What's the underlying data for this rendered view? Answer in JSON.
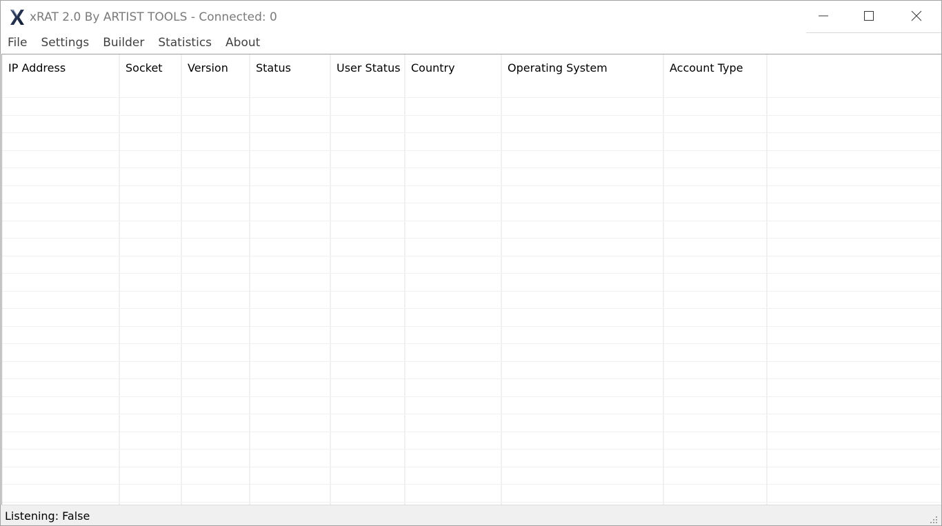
{
  "window": {
    "title": "xRAT 2.0 By ARTIST TOOLS - Connected: 0",
    "app_icon": "x-logo-icon",
    "controls": [
      "minimize-icon",
      "maximize-icon",
      "close-icon"
    ]
  },
  "menu": {
    "items": [
      {
        "label": "File"
      },
      {
        "label": "Settings"
      },
      {
        "label": "Builder"
      },
      {
        "label": "Statistics"
      },
      {
        "label": "About"
      }
    ]
  },
  "table": {
    "columns": [
      {
        "label": "IP Address"
      },
      {
        "label": "Socket"
      },
      {
        "label": "Version"
      },
      {
        "label": "Status"
      },
      {
        "label": "User Status"
      },
      {
        "label": "Country"
      },
      {
        "label": "Operating System"
      },
      {
        "label": "Account Type"
      }
    ],
    "rows": []
  },
  "statusbar": {
    "text": "Listening: False"
  },
  "colors": {
    "title_text": "#7a7a7a",
    "grid_line": "#eef0f2",
    "statusbar_bg": "#f0f0f0"
  }
}
